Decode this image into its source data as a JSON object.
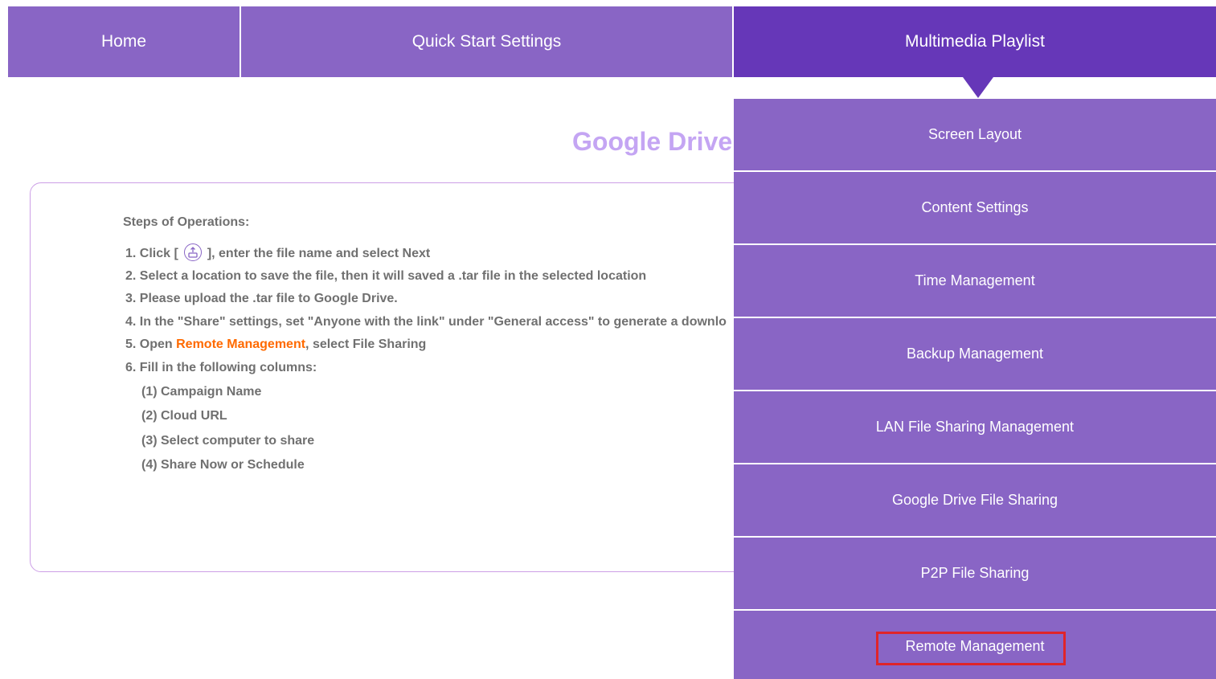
{
  "nav": {
    "home": "Home",
    "quick_start": "Quick Start Settings",
    "multimedia": "Multimedia Playlist"
  },
  "page": {
    "title": "Google Drive"
  },
  "steps": {
    "heading": "Steps of Operations:",
    "s1_pre": "1. Click [",
    "s1_post": "], enter the file name and select Next",
    "s2": "2. Select a location to save the file, then it will saved a .tar file in the selected location",
    "s3": "3. Please upload the .tar file to Google Drive.",
    "s4": "4. In the \"Share\" settings, set \"Anyone with the link\" under \"General access\" to generate a downlo",
    "s5_pre": "5. Open ",
    "s5_link": "Remote Management",
    "s5_post": ", select File Sharing",
    "s6": "6. Fill in the following columns:",
    "sub": [
      "(1) Campaign Name",
      "(2) Cloud URL",
      "(3) Select computer to share",
      "(4) Share Now or Schedule"
    ]
  },
  "dropdown": {
    "items": [
      "Screen Layout",
      "Content Settings",
      "Time Management",
      "Backup Management",
      "LAN File Sharing Management",
      "Google Drive File Sharing",
      "P2P File Sharing",
      "Remote Management"
    ]
  },
  "icons": {
    "export": "export-icon"
  },
  "colors": {
    "nav_bg": "#8965c5",
    "nav_active": "#6637b8",
    "title": "#c4a5f3",
    "link": "#ff6a00",
    "highlight_box": "#e0242a"
  }
}
